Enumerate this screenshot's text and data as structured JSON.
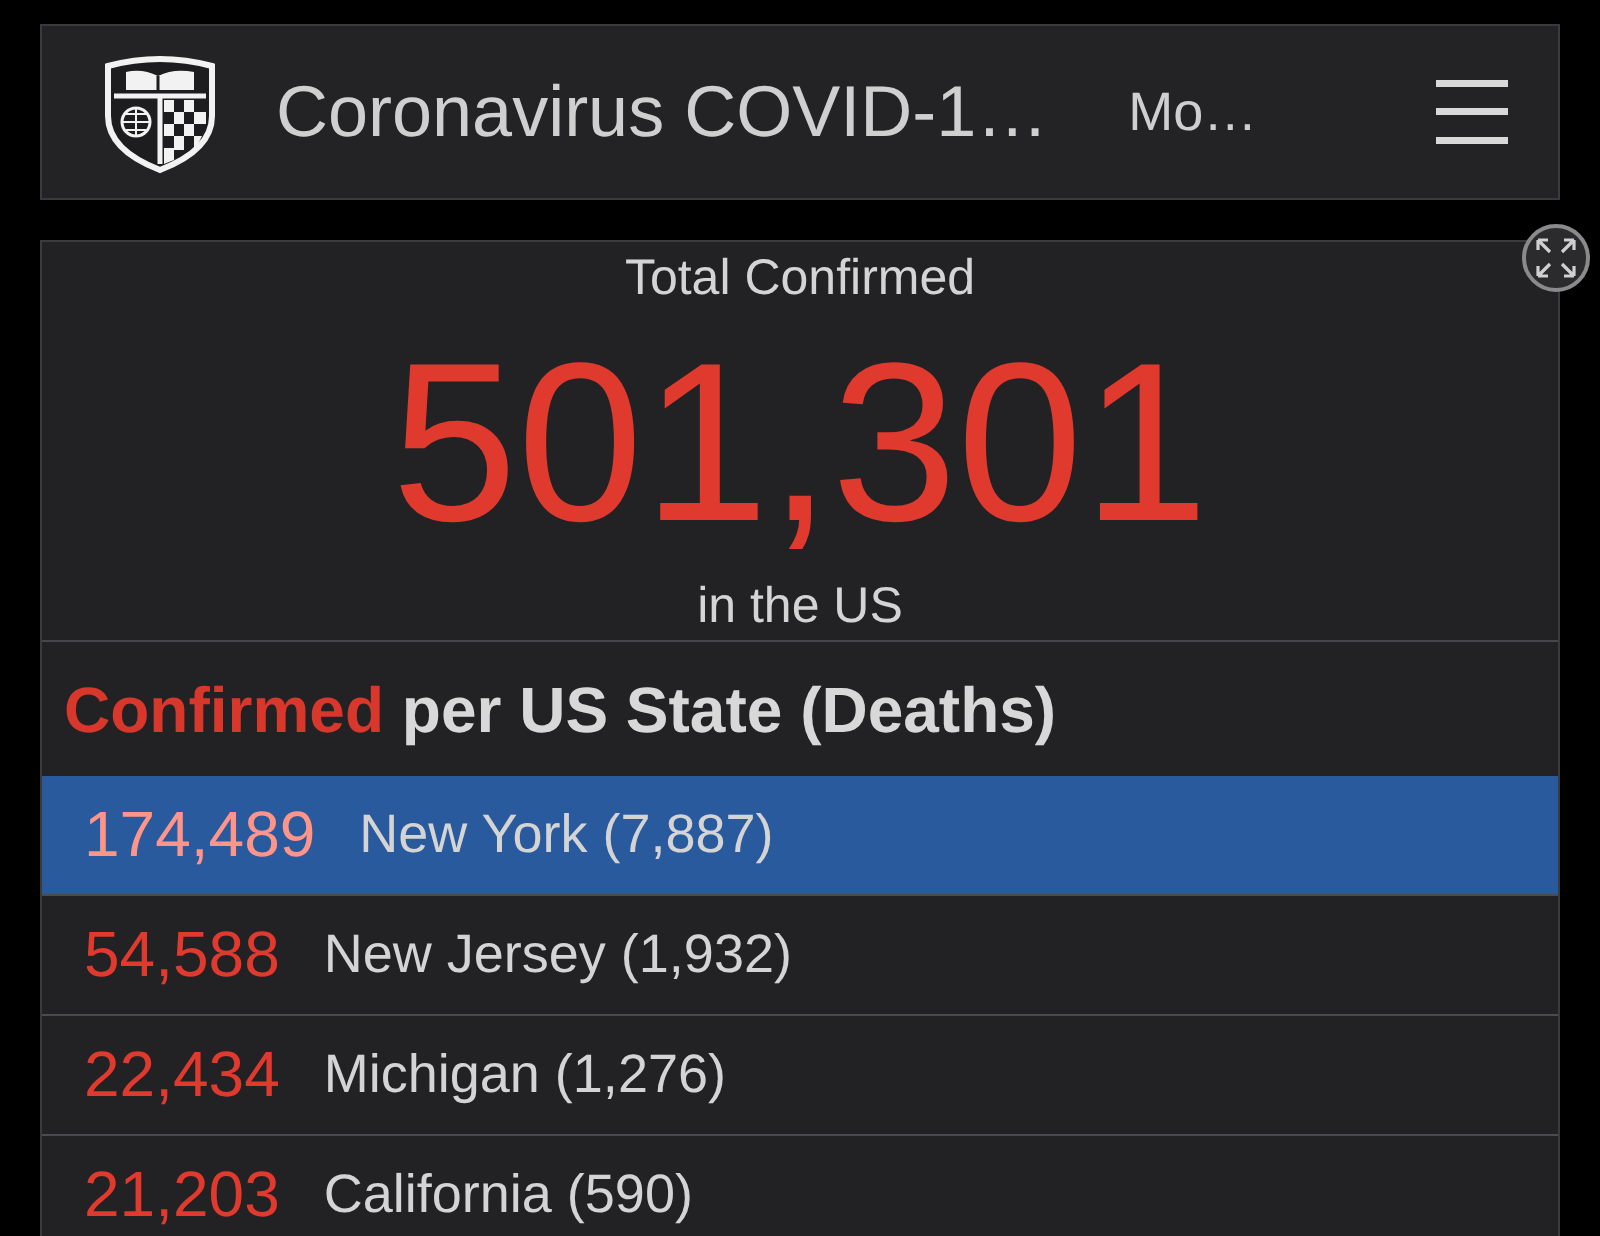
{
  "header": {
    "title": "Coronavirus COVID-1…",
    "more_link": "Mo…"
  },
  "total": {
    "label": "Total Confirmed",
    "value": "501,301",
    "scope": "in the US"
  },
  "state_list": {
    "heading_highlight": "Confirmed",
    "heading_rest": "per US State (Deaths)",
    "rows": [
      {
        "confirmed": "174,489",
        "state": "New York (7,887)",
        "selected": true
      },
      {
        "confirmed": "54,588",
        "state": "New Jersey (1,932)",
        "selected": false
      },
      {
        "confirmed": "22,434",
        "state": "Michigan (1,276)",
        "selected": false
      },
      {
        "confirmed": "21,203",
        "state": "California (590)",
        "selected": false
      }
    ]
  }
}
